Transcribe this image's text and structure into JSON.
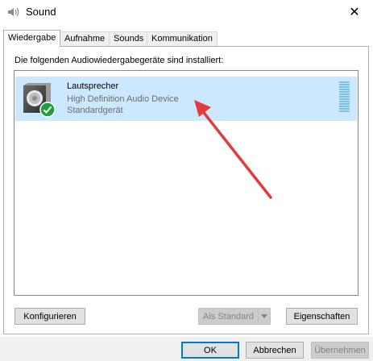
{
  "window": {
    "title": "Sound",
    "icon": "speaker-icon",
    "close_glyph": "✕"
  },
  "tabs": [
    {
      "label": "Wiedergabe",
      "active": true
    },
    {
      "label": "Aufnahme",
      "active": false
    },
    {
      "label": "Sounds",
      "active": false
    },
    {
      "label": "Kommunikation",
      "active": false
    }
  ],
  "playback": {
    "intro": "Die folgenden Audiowiedergabegeräte sind installiert:",
    "devices": [
      {
        "name": "Lautsprecher",
        "description": "High Definition Audio Device",
        "status": "Standardgerät",
        "icon": "speaker-device-icon",
        "badge": "checkmark-icon",
        "selected": true
      }
    ],
    "configure_label": "Konfigurieren",
    "set_default_label": "Als Standard",
    "properties_label": "Eigenschaften"
  },
  "dialog_buttons": {
    "ok": "OK",
    "cancel": "Abbrechen",
    "apply": "Übernehmen"
  },
  "colors": {
    "selection": "#cce8ff",
    "annotation_arrow": "#e03c3c",
    "default_badge": "#1e9e3e"
  }
}
